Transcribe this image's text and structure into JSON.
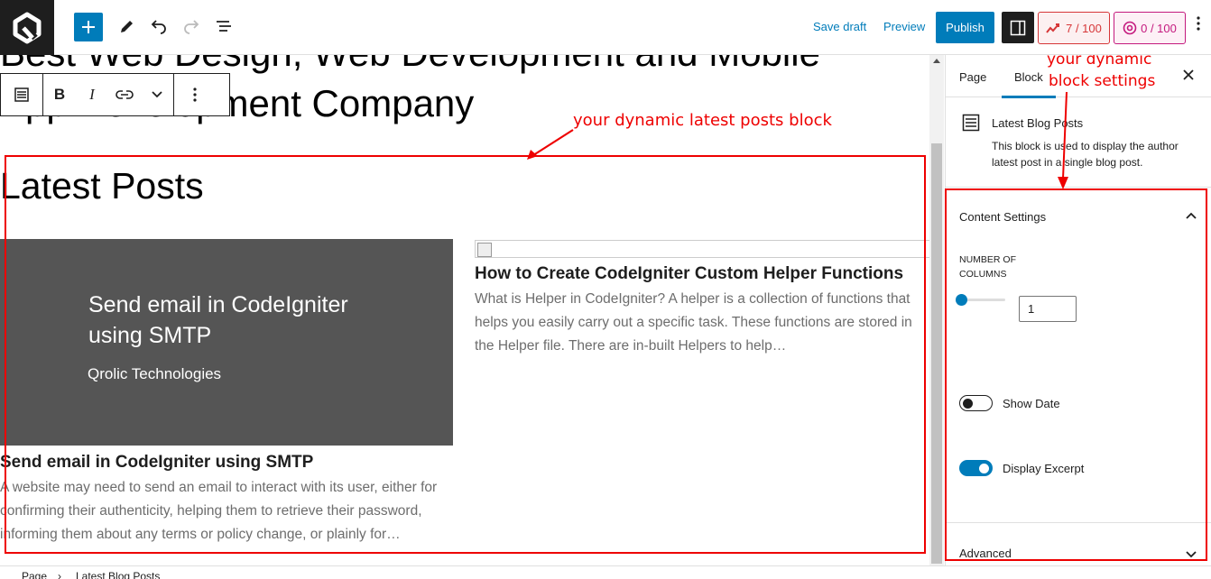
{
  "topbar": {
    "logo": "q-logo-icon",
    "save_draft": "Save draft",
    "preview": "Preview",
    "publish": "Publish",
    "seo_score": "7 / 100",
    "readability_score": "0 / 100"
  },
  "editor": {
    "page_title_line1": "Best Web Design, Web Development and Mobile",
    "page_title_line2": "App Development Company",
    "latest_posts_heading": "Latest Posts",
    "posts": [
      {
        "thumb_title": "Send email in CodeIgniter using SMTP",
        "thumb_subtitle": "Qrolic Technologies",
        "title": "Send email in CodeIgniter using SMTP",
        "excerpt": "A website may need to send an email to interact with its user, either for confirming their authenticity, helping them to retrieve their password, informing them about any terms or policy change, or plainly for…"
      },
      {
        "title": "How to Create CodeIgniter Custom Helper Functions",
        "excerpt": "What is Helper in CodeIgniter?  A helper is a collection of functions that helps you easily carry out a specific task. These functions are stored in the Helper file. There are in-built Helpers to help…"
      }
    ]
  },
  "annotations": {
    "latest_posts_note": "your dynamic latest posts block",
    "block_settings_note_line1": "your dynamic",
    "block_settings_note_line2": "block settings",
    "color": "#ee0000"
  },
  "sidebar": {
    "tabs": [
      "Page",
      "Block"
    ],
    "block_name": "Latest Blog Posts",
    "block_description": "This block is used to display the author latest post in a single blog post.",
    "content_settings": "Content Settings",
    "number_of_columns_label": "Number of Columns",
    "number_of_columns_value": "1",
    "show_date_label": "Show Date",
    "show_date_on": false,
    "display_excerpt_label": "Display Excerpt",
    "display_excerpt_on": true,
    "advanced": "Advanced"
  },
  "breadcrumb": [
    "Page",
    "Latest Blog Posts"
  ],
  "colors": {
    "accent": "#007cba",
    "dark": "#1e1e1e",
    "thumb_bg": "#555555"
  }
}
